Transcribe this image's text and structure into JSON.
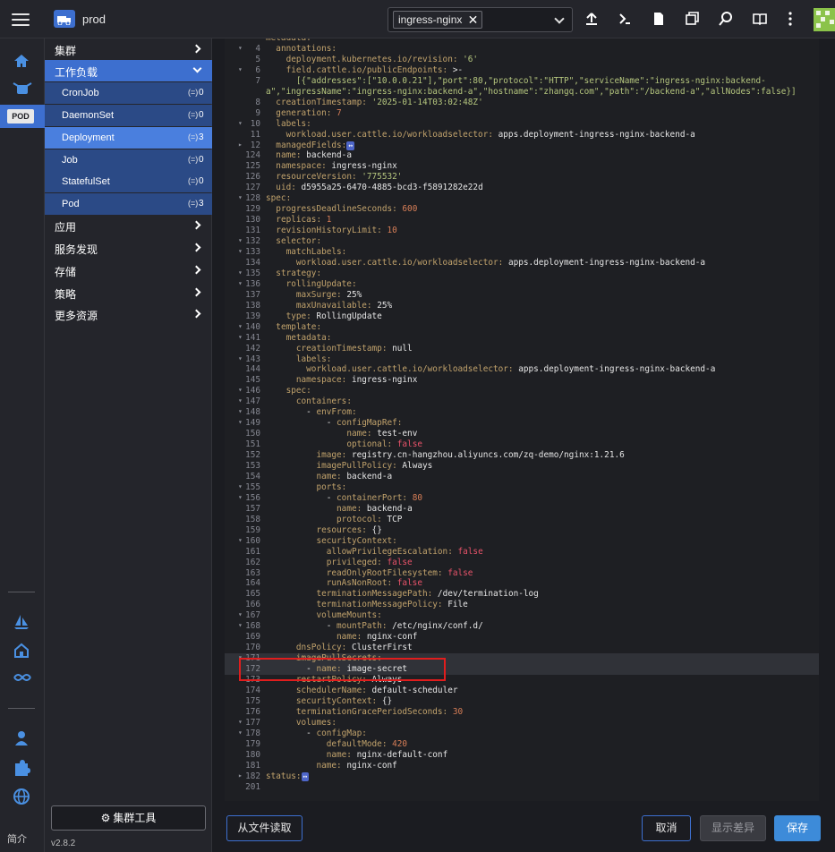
{
  "header": {
    "cluster_name": "prod",
    "namespace_tag": "ingress-nginx",
    "namespace_tag_close": "✕",
    "icons": [
      "menu-icon",
      "upload-icon",
      "terminal-icon",
      "file-icon",
      "copy-icon",
      "search-icon",
      "book-icon",
      "more-vertical-icon"
    ]
  },
  "rail": {
    "pod_badge": "POD",
    "footer": "简介"
  },
  "nav": {
    "groups": [
      {
        "label": "集群"
      },
      {
        "label": "工作负载"
      },
      {
        "label": "应用"
      },
      {
        "label": "服务发现"
      },
      {
        "label": "存储"
      },
      {
        "label": "策略"
      },
      {
        "label": "更多资源"
      }
    ],
    "workload_items": [
      {
        "label": "CronJob",
        "count_icon": "(=)",
        "count": "0"
      },
      {
        "label": "DaemonSet",
        "count_icon": "(=)",
        "count": "0"
      },
      {
        "label": "Deployment",
        "count_icon": "(=)",
        "count": "3"
      },
      {
        "label": "Job",
        "count_icon": "(=)",
        "count": "0"
      },
      {
        "label": "StatefulSet",
        "count_icon": "(=)",
        "count": "0"
      },
      {
        "label": "Pod",
        "count_icon": "(=)",
        "count": "3"
      }
    ],
    "tools_button": "集群工具",
    "version": "v2.8.2"
  },
  "editor": {
    "lines": [
      {
        "n": "",
        "fold": "",
        "c": "metadata:"
      },
      {
        "n": "4",
        "fold": "▾",
        "c": "  annotations:"
      },
      {
        "n": "5",
        "fold": "",
        "c": "    deployment.kubernetes.io/revision: '6'"
      },
      {
        "n": "6",
        "fold": "▾",
        "c": "    field.cattle.io/publicEndpoints: >-"
      },
      {
        "n": "7",
        "fold": "",
        "c": "      [{\"addresses\":[\"10.0.0.21\"],\"port\":80,\"protocol\":\"HTTP\",\"serviceName\":\"ingress-nginx:backend-"
      },
      {
        "n": "",
        "fold": "",
        "c": "a\",\"ingressName\":\"ingress-nginx:backend-a\",\"hostname\":\"zhangq.com\",\"path\":\"/backend-a\",\"allNodes\":false}]"
      },
      {
        "n": "8",
        "fold": "",
        "c": "  creationTimestamp: '2025-01-14T03:02:48Z'"
      },
      {
        "n": "9",
        "fold": "",
        "c": "  generation: 7"
      },
      {
        "n": "10",
        "fold": "▾",
        "c": "  labels:"
      },
      {
        "n": "11",
        "fold": "",
        "c": "    workload.user.cattle.io/workloadselector: apps.deployment-ingress-nginx-backend-a"
      },
      {
        "n": "12",
        "fold": "▸",
        "c": "  managedFields:",
        "collapsed": true
      },
      {
        "n": "124",
        "fold": "",
        "c": "  name: backend-a"
      },
      {
        "n": "125",
        "fold": "",
        "c": "  namespace: ingress-nginx"
      },
      {
        "n": "126",
        "fold": "",
        "c": "  resourceVersion: '775532'"
      },
      {
        "n": "127",
        "fold": "",
        "c": "  uid: d5955a25-6470-4885-bcd3-f5891282e22d"
      },
      {
        "n": "128",
        "fold": "▾",
        "c": "spec:"
      },
      {
        "n": "129",
        "fold": "",
        "c": "  progressDeadlineSeconds: 600"
      },
      {
        "n": "130",
        "fold": "",
        "c": "  replicas: 1"
      },
      {
        "n": "131",
        "fold": "",
        "c": "  revisionHistoryLimit: 10"
      },
      {
        "n": "132",
        "fold": "▾",
        "c": "  selector:"
      },
      {
        "n": "133",
        "fold": "▾",
        "c": "    matchLabels:"
      },
      {
        "n": "134",
        "fold": "",
        "c": "      workload.user.cattle.io/workloadselector: apps.deployment-ingress-nginx-backend-a"
      },
      {
        "n": "135",
        "fold": "▾",
        "c": "  strategy:"
      },
      {
        "n": "136",
        "fold": "▾",
        "c": "    rollingUpdate:"
      },
      {
        "n": "137",
        "fold": "",
        "c": "      maxSurge: 25%"
      },
      {
        "n": "138",
        "fold": "",
        "c": "      maxUnavailable: 25%"
      },
      {
        "n": "139",
        "fold": "",
        "c": "    type: RollingUpdate"
      },
      {
        "n": "140",
        "fold": "▾",
        "c": "  template:"
      },
      {
        "n": "141",
        "fold": "▾",
        "c": "    metadata:"
      },
      {
        "n": "142",
        "fold": "",
        "c": "      creationTimestamp: null"
      },
      {
        "n": "143",
        "fold": "▾",
        "c": "      labels:"
      },
      {
        "n": "144",
        "fold": "",
        "c": "        workload.user.cattle.io/workloadselector: apps.deployment-ingress-nginx-backend-a"
      },
      {
        "n": "145",
        "fold": "",
        "c": "      namespace: ingress-nginx"
      },
      {
        "n": "146",
        "fold": "▾",
        "c": "    spec:"
      },
      {
        "n": "147",
        "fold": "▾",
        "c": "      containers:"
      },
      {
        "n": "148",
        "fold": "▾",
        "c": "        - envFrom:"
      },
      {
        "n": "149",
        "fold": "▾",
        "c": "            - configMapRef:"
      },
      {
        "n": "150",
        "fold": "",
        "c": "                name: test-env"
      },
      {
        "n": "151",
        "fold": "",
        "c": "                optional: false"
      },
      {
        "n": "152",
        "fold": "",
        "c": "          image: registry.cn-hangzhou.aliyuncs.com/zq-demo/nginx:1.21.6"
      },
      {
        "n": "153",
        "fold": "",
        "c": "          imagePullPolicy: Always"
      },
      {
        "n": "154",
        "fold": "",
        "c": "          name: backend-a"
      },
      {
        "n": "155",
        "fold": "▾",
        "c": "          ports:"
      },
      {
        "n": "156",
        "fold": "▾",
        "c": "            - containerPort: 80"
      },
      {
        "n": "157",
        "fold": "",
        "c": "              name: backend-a"
      },
      {
        "n": "158",
        "fold": "",
        "c": "              protocol: TCP"
      },
      {
        "n": "159",
        "fold": "",
        "c": "          resources: {}"
      },
      {
        "n": "160",
        "fold": "▾",
        "c": "          securityContext:"
      },
      {
        "n": "161",
        "fold": "",
        "c": "            allowPrivilegeEscalation: false"
      },
      {
        "n": "162",
        "fold": "",
        "c": "            privileged: false"
      },
      {
        "n": "163",
        "fold": "",
        "c": "            readOnlyRootFilesystem: false"
      },
      {
        "n": "164",
        "fold": "",
        "c": "            runAsNonRoot: false"
      },
      {
        "n": "165",
        "fold": "",
        "c": "          terminationMessagePath: /dev/termination-log"
      },
      {
        "n": "166",
        "fold": "",
        "c": "          terminationMessagePolicy: File"
      },
      {
        "n": "167",
        "fold": "▾",
        "c": "          volumeMounts:"
      },
      {
        "n": "168",
        "fold": "▾",
        "c": "            - mountPath: /etc/nginx/conf.d/"
      },
      {
        "n": "169",
        "fold": "",
        "c": "              name: nginx-conf"
      },
      {
        "n": "170",
        "fold": "",
        "c": "      dnsPolicy: ClusterFirst"
      },
      {
        "n": "171",
        "fold": "▾",
        "c": "      imagePullSecrets:",
        "hl": true
      },
      {
        "n": "172",
        "fold": "",
        "c": "        - name: image-secret",
        "hl": true
      },
      {
        "n": "173",
        "fold": "",
        "c": "      restartPolicy: Always"
      },
      {
        "n": "174",
        "fold": "",
        "c": "      schedulerName: default-scheduler"
      },
      {
        "n": "175",
        "fold": "",
        "c": "      securityContext: {}"
      },
      {
        "n": "176",
        "fold": "",
        "c": "      terminationGracePeriodSeconds: 30"
      },
      {
        "n": "177",
        "fold": "▾",
        "c": "      volumes:"
      },
      {
        "n": "178",
        "fold": "▾",
        "c": "        - configMap:"
      },
      {
        "n": "179",
        "fold": "",
        "c": "            defaultMode: 420"
      },
      {
        "n": "180",
        "fold": "",
        "c": "            name: nginx-default-conf"
      },
      {
        "n": "181",
        "fold": "",
        "c": "          name: nginx-conf"
      },
      {
        "n": "182",
        "fold": "▸",
        "c": "status:",
        "collapsed": true
      },
      {
        "n": "201",
        "fold": "",
        "c": ""
      }
    ],
    "collapsed_marker": "↔"
  },
  "footer": {
    "read_file": "从文件读取",
    "cancel": "取消",
    "show_diff": "显示差异",
    "save": "保存"
  },
  "colors": {
    "accent": "#3d6fcf",
    "save": "#3d8bd9",
    "highlight_border": "#e11d1d"
  }
}
